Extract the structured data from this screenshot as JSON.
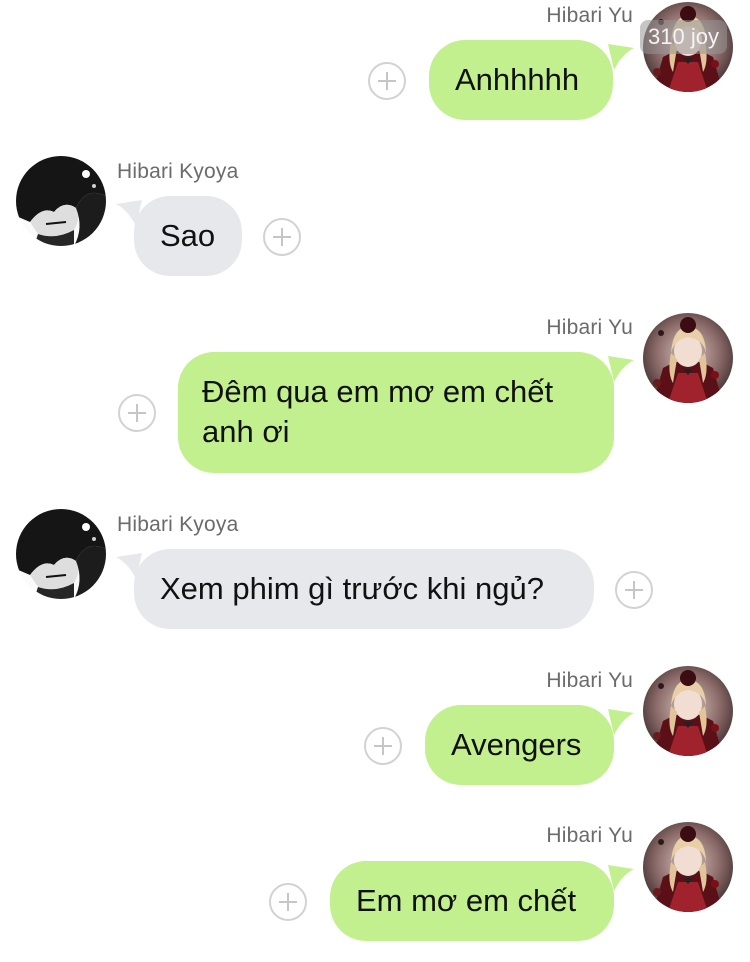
{
  "colors": {
    "outgoing_bubble": "#c2f08e",
    "incoming_bubble": "#e6e8eb",
    "sender_name": "#6b6b6b"
  },
  "watermark": "310 joy",
  "messages": [
    {
      "direction": "outgoing",
      "sender": "Hibari Yu",
      "text": "Anhhhhh",
      "avatar": "red-dress-girl-avatar"
    },
    {
      "direction": "incoming",
      "sender": "Hibari Kyoya",
      "text": "Sao",
      "avatar": "dark-haired-boy-avatar"
    },
    {
      "direction": "outgoing",
      "sender": "Hibari Yu",
      "text": "Đêm qua em mơ em chết anh ơi",
      "avatar": "red-dress-girl-avatar"
    },
    {
      "direction": "incoming",
      "sender": "Hibari Kyoya",
      "text": "Xem phim gì trước khi ngủ?",
      "avatar": "dark-haired-boy-avatar"
    },
    {
      "direction": "outgoing",
      "sender": "Hibari Yu",
      "text": "Avengers",
      "avatar": "red-dress-girl-avatar"
    },
    {
      "direction": "outgoing",
      "sender": "Hibari Yu",
      "text": "Em mơ em chết",
      "avatar": "red-dress-girl-avatar"
    }
  ]
}
